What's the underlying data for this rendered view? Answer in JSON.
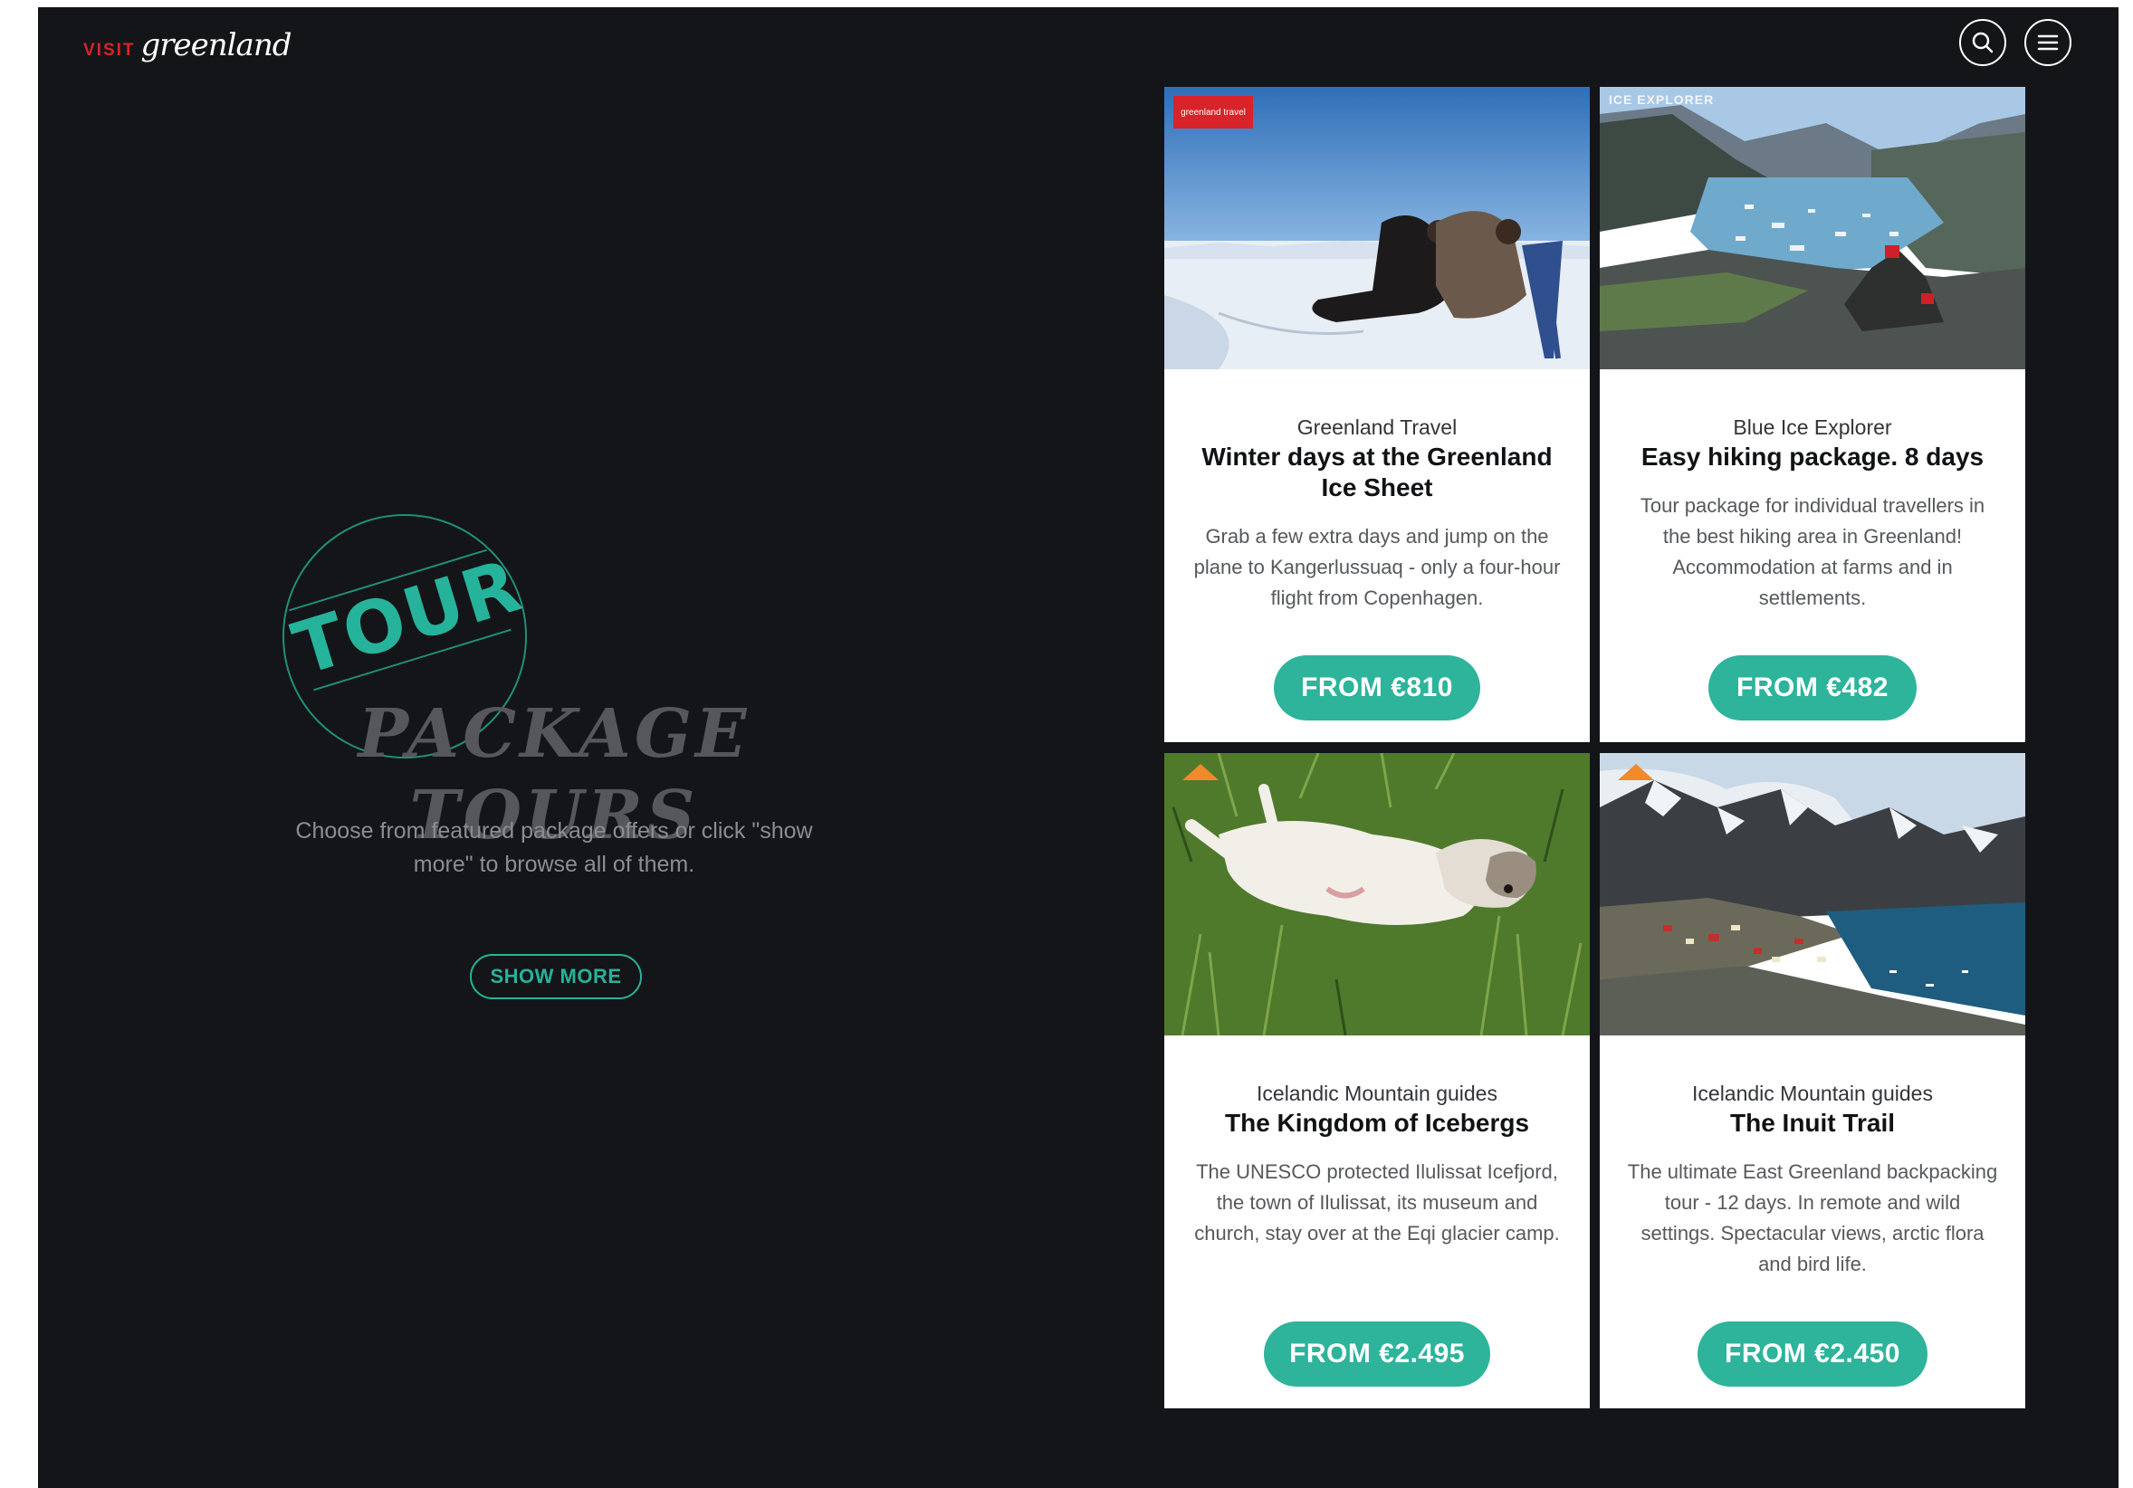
{
  "header": {
    "logo_visit": "VISIT",
    "logo_name": "greenland",
    "search_icon": "search-icon",
    "menu_icon": "hamburger-menu-icon"
  },
  "hero": {
    "stamp_text": "TOUR",
    "title": "PACKAGE TOURS",
    "description": "Choose from featured package offers or click \"show more\" to browse all of them.",
    "show_more_label": "SHOW MORE"
  },
  "colors": {
    "background": "#141518",
    "accent": "#2db49b",
    "brand_red": "#d8232a"
  },
  "cards": [
    {
      "provider": "Greenland Travel",
      "title": "Winter days at the Greenland Ice Sheet",
      "description": "Grab a few extra days and jump on the plane to Kangerlussuaq - only a four-hour flight from Copenhagen.",
      "price": "FROM €810",
      "image": "photo: two people relaxing on a dog sled on the snowy ice sheet",
      "badge": "greenland travel"
    },
    {
      "provider": "Blue Ice Explorer",
      "title": "Easy hiking package. 8 days",
      "description": "Tour package for individual travellers in the best hiking area in Greenland! Accommodation at farms and in settlements.",
      "price": "FROM €482",
      "image": "photo: fjord with floating ice and rocky hillside",
      "watermark": "ICE EXPLORER"
    },
    {
      "provider": "Icelandic Mountain guides",
      "title": "The Kingdom of Icebergs",
      "description": "The UNESCO protected Ilulissat Icefjord, the town of Ilulissat, its museum and church, stay over at the Eqi glacier camp.",
      "price": "FROM €2.495",
      "image": "photo: husky puppy lying on its back in green grass"
    },
    {
      "provider": "Icelandic Mountain guides",
      "title": "The Inuit Trail",
      "description": "The ultimate East Greenland backpacking tour - 12 days. In remote and wild settings. Spectacular views, arctic flora and bird life.",
      "price": "FROM €2.450",
      "image": "photo: snowy mountains above a coastal village and bay"
    }
  ]
}
